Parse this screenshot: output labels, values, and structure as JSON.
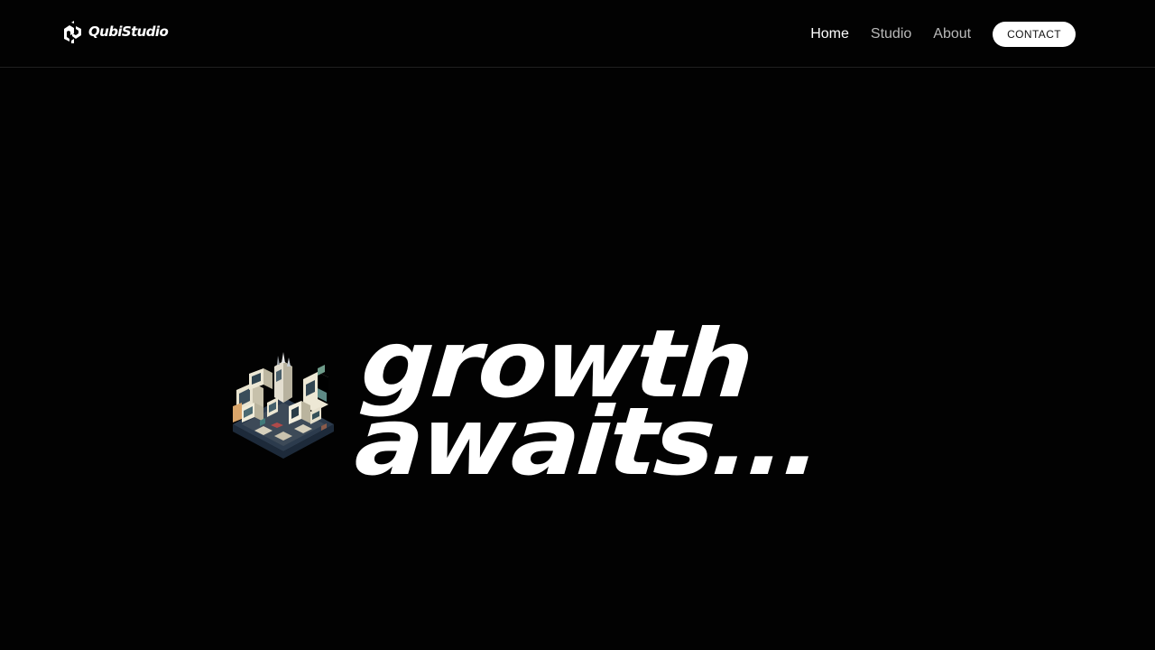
{
  "header": {
    "logo": {
      "icon": "qubi-logo-icon",
      "text": "QubiStudio"
    },
    "nav": {
      "items": [
        {
          "label": "Home",
          "active": true
        },
        {
          "label": "Studio",
          "active": false
        },
        {
          "label": "About",
          "active": false
        }
      ],
      "contact_label": "CONTACT"
    }
  },
  "hero": {
    "illustration": "isometric-computer-room-illustration",
    "heading_line1": "growth",
    "heading_line2": "awaits..."
  },
  "colors": {
    "background": "#020202",
    "text": "#ffffff",
    "nav_inactive": "#b9b9b9",
    "divider": "#1f1f1f",
    "button_bg": "#ffffff",
    "button_text": "#111111"
  }
}
